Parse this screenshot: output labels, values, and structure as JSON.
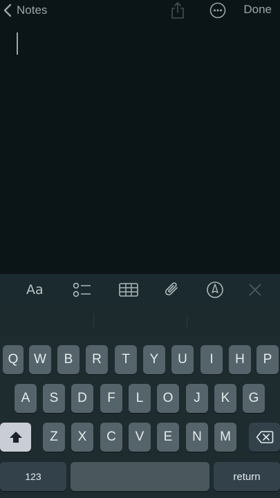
{
  "navbar": {
    "back_label": "Notes",
    "done_label": "Done"
  },
  "toolbar": {
    "aa_label": "Aa"
  },
  "keyboard": {
    "row1": [
      "Q",
      "W",
      "B",
      "R",
      "T",
      "Y",
      "U",
      "I",
      "H",
      "P"
    ],
    "row2": [
      "A",
      "S",
      "D",
      "F",
      "L",
      "O",
      "J",
      "K",
      "G"
    ],
    "row3": [
      "Z",
      "X",
      "C",
      "V",
      "E",
      "N",
      "M"
    ],
    "numbers_label": "123",
    "return_label": "return"
  },
  "icons": {
    "back": "chevron-left-icon",
    "share": "share-icon",
    "more": "more-icon",
    "checklist": "checklist-icon",
    "table": "table-icon",
    "attach": "paperclip-icon",
    "markup": "markup-pen-icon",
    "close": "close-icon",
    "shift": "shift-icon",
    "delete": "backspace-icon"
  },
  "colors": {
    "background": "#0b1416",
    "keyboard": "#1e2b2f",
    "key": "#55646a",
    "shift_key": "#c9ced6"
  }
}
